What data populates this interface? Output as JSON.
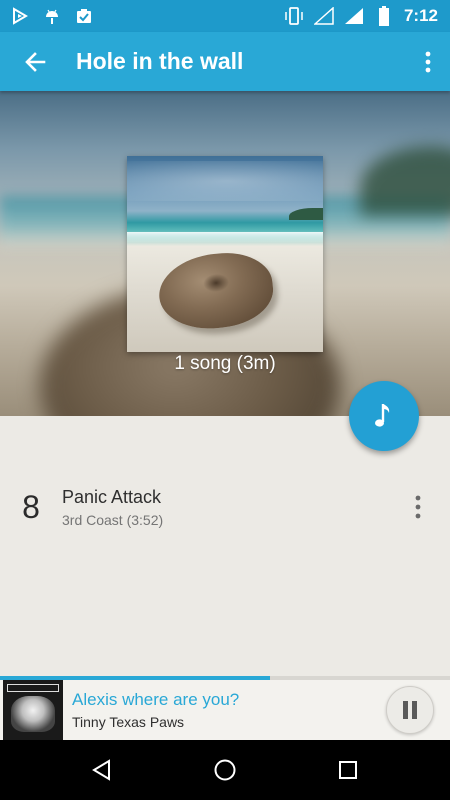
{
  "status_bar": {
    "time": "7:12",
    "left_icons": [
      "play-store-icon",
      "android-icon",
      "clipboard-check-icon"
    ],
    "right_icons": [
      "vibrate-icon",
      "wifi-icon",
      "signal-icon",
      "battery-icon"
    ]
  },
  "app_bar": {
    "title": "Hole in the wall",
    "back_icon": "arrow-back-icon",
    "menu_icon": "more-vert-icon",
    "color": "#29a8d6"
  },
  "album": {
    "summary": "1 song (3m)"
  },
  "fab": {
    "icon": "music-note-icon",
    "color": "#23a0d4"
  },
  "tracks": [
    {
      "number": "8",
      "title": "Panic Attack",
      "subtitle": "3rd Coast (3:52)",
      "menu_icon": "more-vert-icon"
    }
  ],
  "now_playing": {
    "title": "Alexis where are you?",
    "artist": "Tinny Texas Paws",
    "progress": 0.6,
    "control_icon": "pause-icon",
    "accent": "#29a8d6"
  },
  "nav_bar": {
    "icons": [
      "back-triangle-icon",
      "home-circle-icon",
      "recents-square-icon"
    ]
  }
}
